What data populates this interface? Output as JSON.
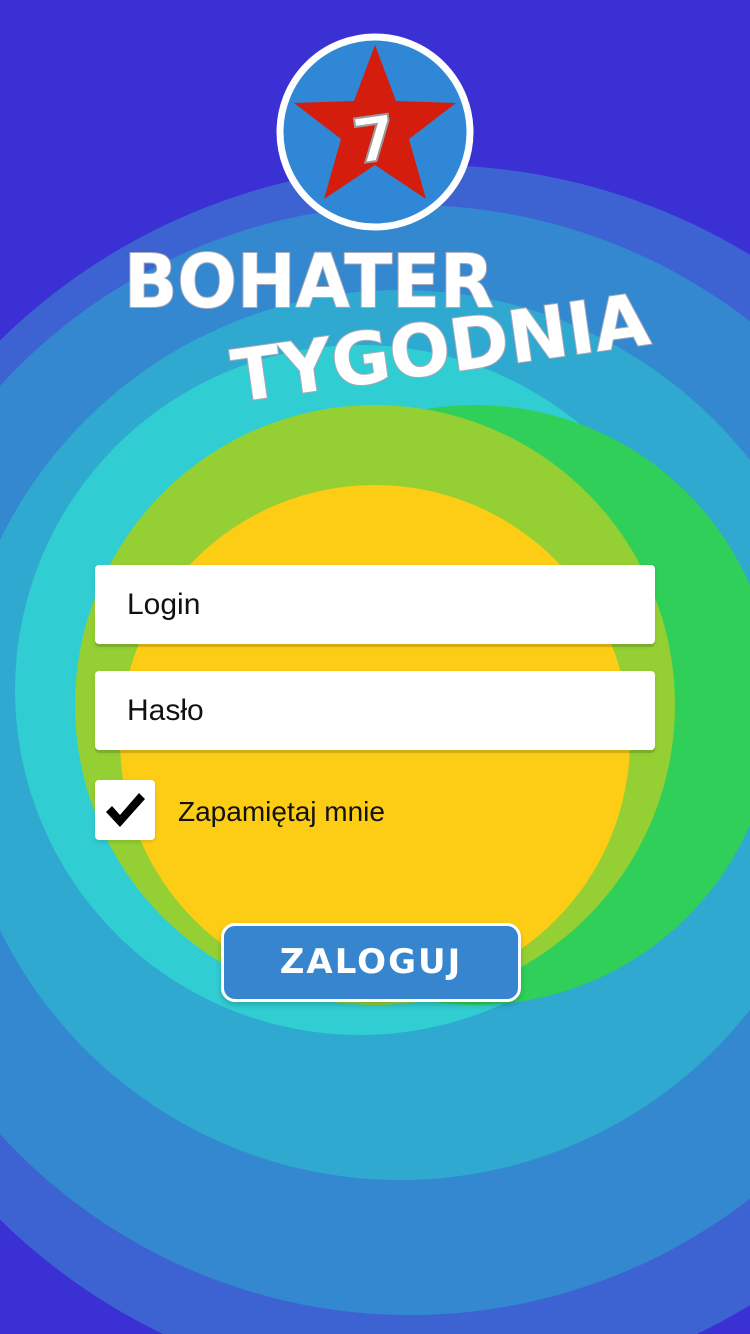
{
  "app": {
    "logo_number": "7",
    "title_line1": "BOHATER",
    "title_line2": "TYGODNIA"
  },
  "form": {
    "login_placeholder": "Login",
    "password_placeholder": "Hasło",
    "remember_label": "Zapamiętaj mnie",
    "remember_checked": true,
    "submit_label": "ZALOGUJ"
  },
  "colors": {
    "background": "#3a30d4",
    "ring_blue": "#3d63d2",
    "ring_mid_blue": "#3388d0",
    "ring_teal": "#2fa9cf",
    "ring_cyan": "#30cdd2",
    "green": "#2fcf59",
    "lime": "#94d033",
    "yellow": "#fdcd16",
    "star_red": "#d41d0c",
    "badge_blue": "#3087d6",
    "button_blue": "#3785cf"
  },
  "icons": {
    "logo_star": "star-icon",
    "checkbox_mark": "checkmark-icon"
  }
}
